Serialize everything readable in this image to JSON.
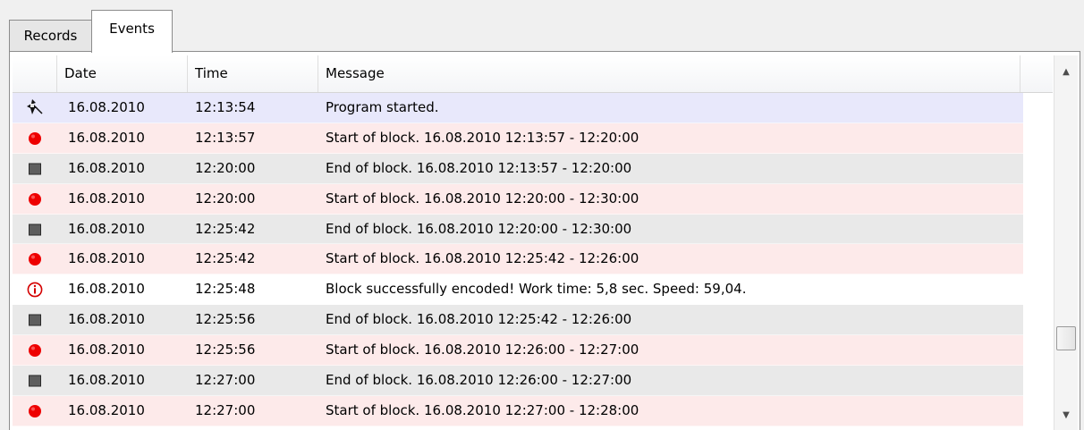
{
  "tabs": [
    {
      "label": "Records",
      "active": false
    },
    {
      "label": "Events",
      "active": true
    }
  ],
  "columns": [
    "",
    "Date",
    "Time",
    "Message",
    ""
  ],
  "icons": {
    "program": "program-start-icon",
    "start": "red-dot-icon",
    "end": "gray-square-icon",
    "info": "info-circle-icon"
  },
  "colors": {
    "program_row": "#e8e8fb",
    "start_row": "#fdeaea",
    "end_row": "#e9e9e9",
    "info_row": "#ffffff",
    "red_dot": "#ee0000",
    "gray_square": "#5e5e5e",
    "info_ring": "#d40000"
  },
  "rows": [
    {
      "kind": "program",
      "date": "16.08.2010",
      "time": "12:13:54",
      "message": "Program started."
    },
    {
      "kind": "start",
      "date": "16.08.2010",
      "time": "12:13:57",
      "message": "Start of block. 16.08.2010 12:13:57 - 12:20:00"
    },
    {
      "kind": "end",
      "date": "16.08.2010",
      "time": "12:20:00",
      "message": "End of block. 16.08.2010 12:13:57 - 12:20:00"
    },
    {
      "kind": "start",
      "date": "16.08.2010",
      "time": "12:20:00",
      "message": "Start of block. 16.08.2010 12:20:00 - 12:30:00"
    },
    {
      "kind": "end",
      "date": "16.08.2010",
      "time": "12:25:42",
      "message": "End of block. 16.08.2010 12:20:00 - 12:30:00"
    },
    {
      "kind": "start",
      "date": "16.08.2010",
      "time": "12:25:42",
      "message": "Start of block. 16.08.2010 12:25:42 - 12:26:00"
    },
    {
      "kind": "info",
      "date": "16.08.2010",
      "time": "12:25:48",
      "message": "Block successfully encoded! Work time: 5,8 sec. Speed: 59,04."
    },
    {
      "kind": "end",
      "date": "16.08.2010",
      "time": "12:25:56",
      "message": "End of block. 16.08.2010 12:25:42 - 12:26:00"
    },
    {
      "kind": "start",
      "date": "16.08.2010",
      "time": "12:25:56",
      "message": "Start of block. 16.08.2010 12:26:00 - 12:27:00"
    },
    {
      "kind": "end",
      "date": "16.08.2010",
      "time": "12:27:00",
      "message": "End of block. 16.08.2010 12:26:00 - 12:27:00"
    },
    {
      "kind": "start",
      "date": "16.08.2010",
      "time": "12:27:00",
      "message": "Start of block. 16.08.2010 12:27:00 - 12:28:00"
    }
  ],
  "scrollbar": {
    "position": 0.82
  }
}
